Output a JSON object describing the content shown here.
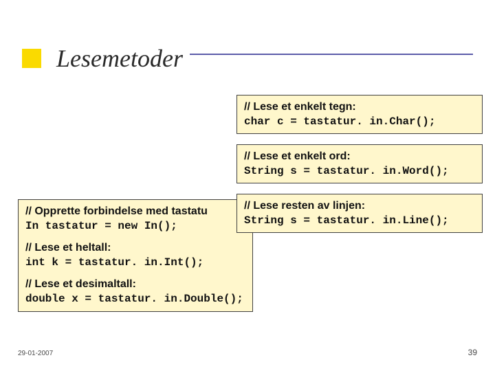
{
  "title": "Lesemetoder",
  "left_box": {
    "sec1": {
      "comment": "// Opprette forbindelse med tastatu",
      "code": "In tastatur = new In();"
    },
    "sec2": {
      "comment": "// Lese et heltall:",
      "code": "int k = tastatur. in.Int();"
    },
    "sec3": {
      "comment": "// Lese et desimaltall:",
      "code": "double x = tastatur. in.Double();"
    }
  },
  "box_char": {
    "comment": "// Lese et enkelt tegn:",
    "code": "char c = tastatur. in.Char();"
  },
  "box_word": {
    "comment": "// Lese et enkelt ord:",
    "code": "String s = tastatur. in.Word();"
  },
  "box_line": {
    "comment": "// Lese resten av linjen:",
    "code": "String s = tastatur. in.Line();"
  },
  "footer": {
    "date": "29-01-2007",
    "page": "39"
  }
}
